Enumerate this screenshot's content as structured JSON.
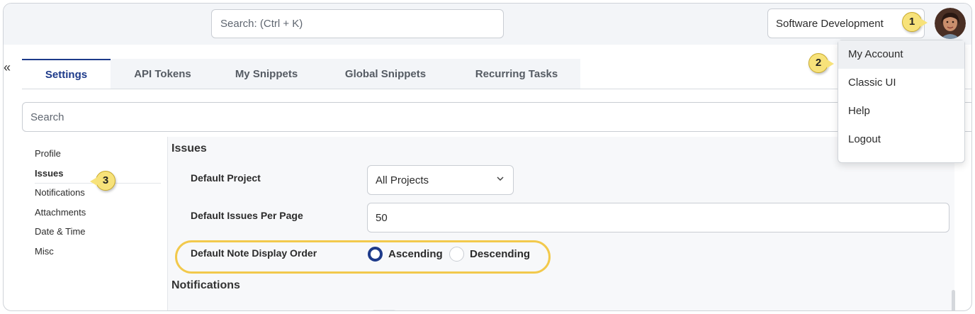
{
  "header": {
    "search_placeholder": "Search: (Ctrl + K)",
    "theme_icon": "moon-icon",
    "project": "Software Development",
    "avatar_icon": "user-avatar"
  },
  "callouts": [
    "1",
    "2",
    "3"
  ],
  "nav": {
    "collapse": "«"
  },
  "tabs": [
    "Settings",
    "API Tokens",
    "My Snippets",
    "Global Snippets",
    "Recurring Tasks"
  ],
  "settings_search_placeholder": "Search",
  "sidebar": [
    "Profile",
    "Issues",
    "Notifications",
    "Attachments",
    "Date & Time",
    "Misc"
  ],
  "issues": {
    "title": "Issues",
    "default_project_label": "Default Project",
    "default_project_value": "All Projects",
    "per_page_label": "Default Issues Per Page",
    "per_page_value": "50",
    "note_order_label": "Default Note Display Order",
    "options": [
      "Ascending",
      "Descending"
    ],
    "selected": "Ascending"
  },
  "notifications": {
    "title": "Notifications"
  },
  "account_menu": [
    "My Account",
    "Classic UI",
    "Help",
    "Logout"
  ],
  "colors": {
    "accent": "#1d3a8a",
    "callout": "#f7e27a",
    "highlight": "#f2c94c"
  }
}
